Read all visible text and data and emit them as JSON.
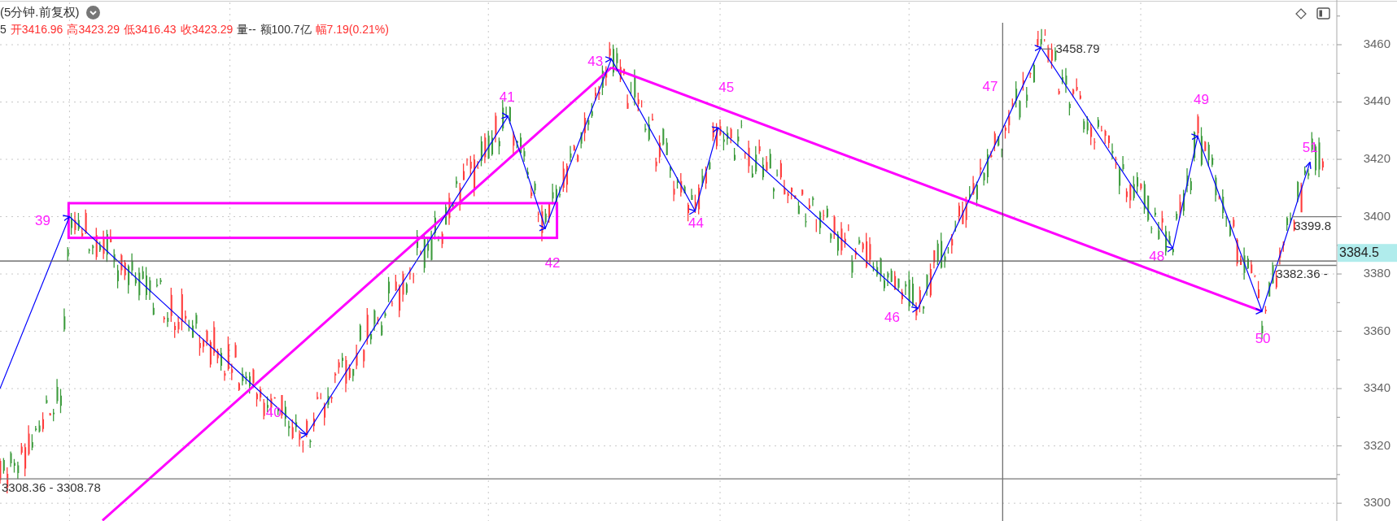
{
  "header": {
    "title": "(5分钟.前复权)",
    "quote": [
      {
        "text": "5",
        "kind": "flat"
      },
      {
        "text": "开3416.96",
        "kind": "up"
      },
      {
        "text": "高3423.29",
        "kind": "up"
      },
      {
        "text": "低3416.43",
        "kind": "up"
      },
      {
        "text": "收3423.29",
        "kind": "up"
      },
      {
        "text": "量--",
        "kind": "flat"
      },
      {
        "text": "额100.7亿",
        "kind": "flat"
      },
      {
        "text": "幅7.19(0.21%)",
        "kind": "up"
      }
    ]
  },
  "chart": {
    "axis_labels": [
      "3460",
      "3440",
      "3420",
      "3400",
      "3380",
      "3360",
      "3340",
      "3320",
      "3300"
    ],
    "wave_labels": [
      "39",
      "40",
      "41",
      "42",
      "43",
      "44",
      "45",
      "46",
      "47",
      "48",
      "49",
      "50",
      "51"
    ],
    "crosshair": {
      "label": "3384.5"
    },
    "price_lines": [
      {
        "label": "3308.36 - 3308.78",
        "kind": "below"
      },
      {
        "label": "3399.8",
        "kind": "below"
      },
      {
        "label": "3382.36 -",
        "kind": "below"
      },
      {
        "label": "3458.79",
        "kind": "right"
      }
    ]
  }
}
